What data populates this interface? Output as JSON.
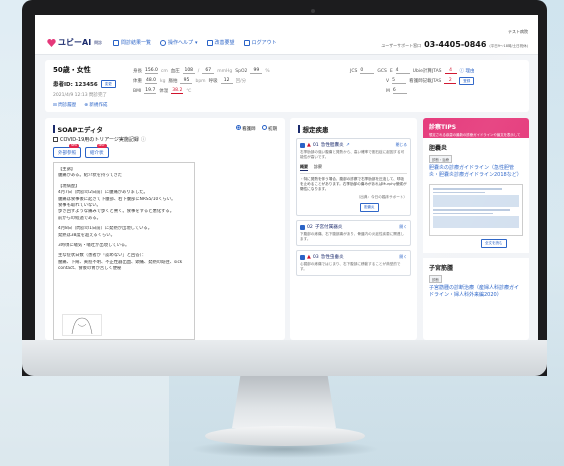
{
  "header": {
    "logo_text": "ユビーAI",
    "logo_sub": "問診",
    "nav": [
      {
        "label": "問診結果一覧",
        "icon": "list-icon"
      },
      {
        "label": "操作ヘルプ",
        "icon": "help-icon"
      },
      {
        "label": "改善要望",
        "icon": "comment-icon"
      },
      {
        "label": "ログアウト",
        "icon": "logout-icon"
      }
    ],
    "user_name": "テスト病院",
    "support_label": "ユーザーサポート窓口",
    "support_phone": "03-4405-0846",
    "support_hours": "(平日9〜18時/土日祝休)"
  },
  "patient": {
    "age_sex": "50歳・女性",
    "id_label": "患者ID: 123456",
    "edit_label": "変更",
    "datetime": "2021/4/9 12:13 問診完了",
    "links": [
      "問診履歴",
      "新規作成"
    ],
    "vitals": {
      "height": {
        "label": "身長",
        "value": "156.0",
        "unit": "cm"
      },
      "bp_label": "血圧",
      "bp_sys": "108",
      "bp_dia": "67",
      "bp_unit": "mmHg",
      "spo2": {
        "label": "SpO2",
        "value": "99",
        "unit": "%"
      },
      "weight": {
        "label": "体重",
        "value": "48.0",
        "unit": "kg"
      },
      "pulse": {
        "label": "脈拍",
        "value": "95",
        "unit": "bpm"
      },
      "resp": {
        "label": "呼吸",
        "value": "12",
        "unit": "回/分"
      },
      "bmi": {
        "label": "BMI",
        "value": "19.7"
      },
      "temp": {
        "label": "体温",
        "value": "38.2",
        "unit": "℃"
      }
    },
    "scores": {
      "jcs": {
        "label": "JCS",
        "value": "0"
      },
      "gcs_label": "GCS",
      "gcs_e": {
        "label": "E",
        "value": "4"
      },
      "gcs_v": {
        "label": "V",
        "value": "5"
      },
      "gcs_m": {
        "label": "M",
        "value": "6"
      },
      "ubie": {
        "label": "Ubie計算JTAS",
        "value": "4"
      },
      "reason": "理由",
      "nurse": {
        "label": "看護師記載JTAS",
        "value": "2"
      },
      "register_label": "登録"
    }
  },
  "soap": {
    "title": "SOAPエディタ",
    "radio_opts": [
      "看護師",
      "初期"
    ],
    "covid_label": "COVID-19用のトリアージ実施記録",
    "pills": [
      {
        "label": "外部参照",
        "badge": "NEW"
      },
      {
        "label": "紹介状",
        "badge": "NEW"
      }
    ],
    "lines": [
      "【主訴】",
      "腹痛がある。紹介状を持ってきた",
      "",
      "【現病歴】",
      "4月7日（問診の2日前）に腹痛がありました。",
      "腹痛は食事後に起きて下腹部、右下腹部にNRS5/10くらい。",
      "食事も取れていない。",
      "歩き回すような痛みで歩くと響く。食事をすると悪化する。",
      "前からの経過である。",
      "",
      "4月8日（問診の1日前）に発熱が出現している。",
      "発熱は38度を超えるくらい。",
      "",
      "3時頃に嘔気・嘔吐が出現している。",
      "",
      "主な症状日数（患者が「認めない」と回答）：",
      "腰痛、下痢、黄疸不明、不正性器出血、頭痛、発熱の既往、sick",
      "contact、食後の胃が苦しく便秘"
    ]
  },
  "dx": {
    "title": "想定疾患",
    "items": [
      {
        "num": "01",
        "name": "急性胆嚢炎",
        "toggle": "閉じる",
        "sub": "右季肋部の強い腹痛と発熱から、高い確率で胆石症に起因する可能性が高いです。",
        "tabs": [
          "概要",
          "診察"
        ],
        "body": "・特に発熱を伴う場合、腹部の診察で右季肋部を圧迫して、呼吸を止めることがあります。右季肋部の痛みがあればMurphy徴候が陽性になります。",
        "source": "（出典：今日の臨床サポート）",
        "button": "胆嚢炎"
      },
      {
        "num": "02",
        "name": "子宮付属器炎",
        "toggle": "開く",
        "sub": "下腹部の疼痛、右下腹部痛があり、骨盤内の炎症性疾患に関連します。"
      },
      {
        "num": "03",
        "name": "急性虫垂炎",
        "toggle": "開く",
        "sub": "心窩部の疼痛ではじまり、右下腹部に移動することが典型的です。"
      }
    ]
  },
  "tips": {
    "title": "診察TIPS",
    "subtitle": "想定される疾患の最新の診療ガイドラインや論文を表示しています",
    "sections": [
      {
        "name": "胆嚢炎",
        "tag": "診断・治療",
        "link": "胆嚢炎の診療ガイドライン（急性胆管炎・胆嚢炎診療ガイドライン2018など）",
        "more": "全文を読む"
      },
      {
        "name": "子宮筋腫",
        "tag": "診断",
        "link": "子宮筋腫の診断治療（産婦人科診療ガイドライン・婦人科外来編2020）"
      }
    ]
  }
}
